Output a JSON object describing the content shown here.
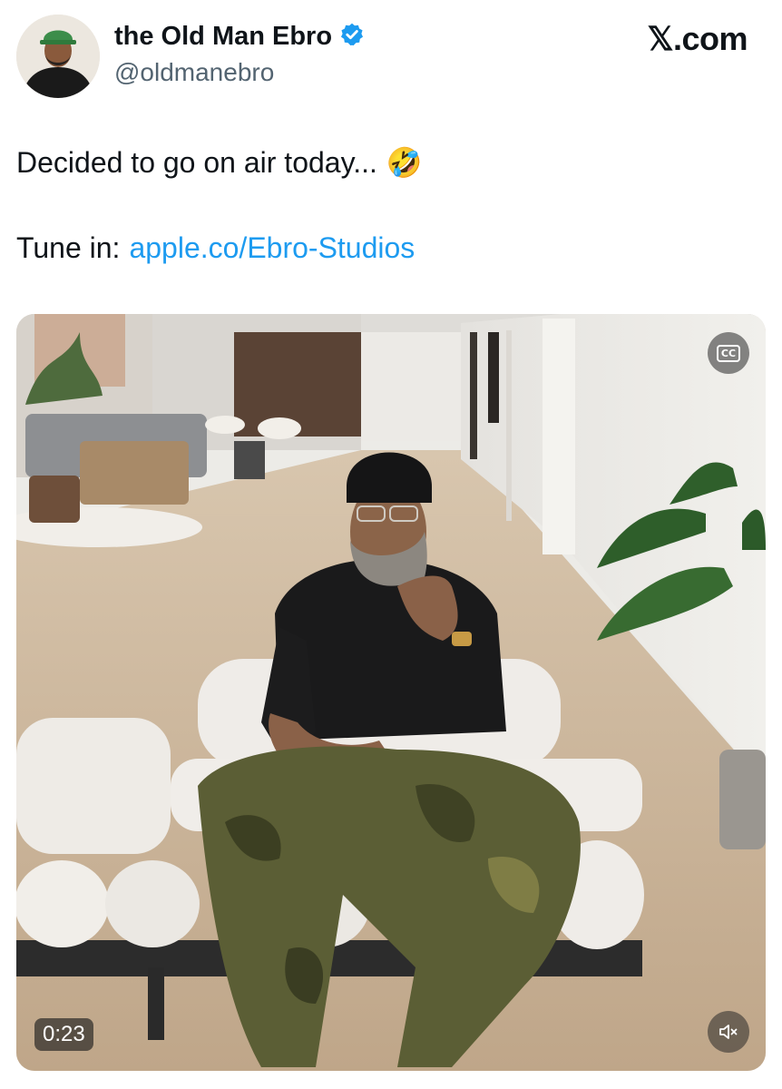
{
  "author": {
    "display_name": "the Old Man Ebro",
    "handle": "@oldmanebro",
    "verified": true,
    "avatar_icon": "profile-photo"
  },
  "brand": "𝕏.com",
  "tweet": {
    "text_line1": "Decided to go on air today...",
    "emoji_line1": "🤣",
    "line2_prefix": "Tune in:",
    "link_text": "apple.co/Ebro-Studios"
  },
  "media": {
    "type": "video",
    "duration": "0:23",
    "cc_label": "CC",
    "cc_icon": "closed-captions-icon",
    "mute_icon": "speaker-muted-icon"
  },
  "colors": {
    "link": "#1d9bf0",
    "verified_badge": "#1d9bf0",
    "secondary_text": "#536471"
  }
}
